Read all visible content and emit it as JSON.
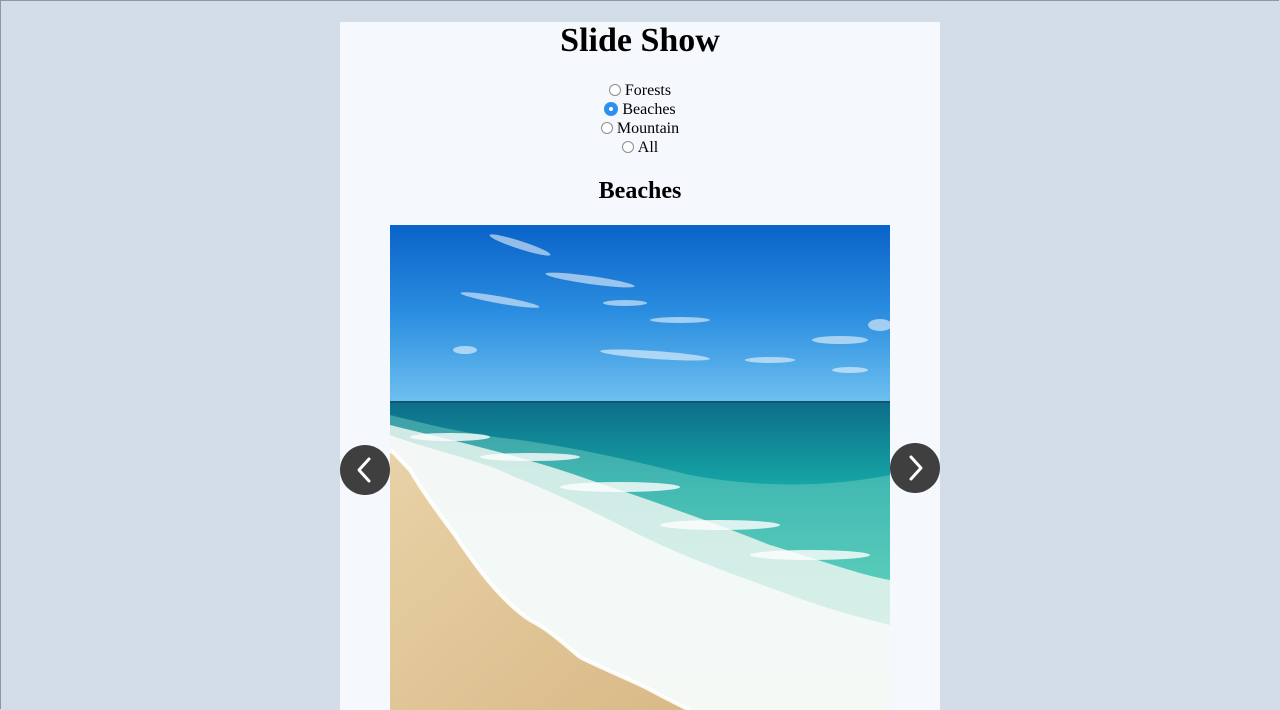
{
  "page": {
    "title": "Slide Show"
  },
  "categories": {
    "options": [
      {
        "label": "Forests",
        "checked": false
      },
      {
        "label": "Beaches",
        "checked": true
      },
      {
        "label": "Mountain",
        "checked": false
      },
      {
        "label": "All",
        "checked": false
      }
    ]
  },
  "slideshow": {
    "heading": "Beaches",
    "image_alt": "beach with turquoise sea and waves",
    "prev_icon": "chevron-left-icon",
    "next_icon": "chevron-right-icon"
  },
  "colors": {
    "background": "#d3dde8",
    "panel": "#f5f8fc",
    "nav_button": "#3f3f3f",
    "radio_checked": "#2e8ff0"
  }
}
